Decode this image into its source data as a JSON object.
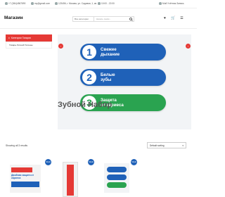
{
  "topbar": {
    "phone": "+7 (084)4567890",
    "email": "my@gmail.com",
    "address": "123456, г. Москва, ул. Садовая, 1, кв. 1",
    "hours": "10:00 - 22:00",
    "account": "Мой Учётная Запись"
  },
  "header": {
    "logo": "Магазин",
    "search_category": "Все категории",
    "search_placeholder": "Начать поиск..."
  },
  "nav": {
    "categories_button": "Категории Товаров",
    "category_item": "Товары Личной Гигиены"
  },
  "banner": {
    "item1_num": "1",
    "item1_text": "Свежее\nдыхание",
    "item2_num": "2",
    "item2_text": "Белые\nзубы",
    "item3_num": "3",
    "item3_text": "Защита\nот кариеса",
    "caption": "Зубной Набор"
  },
  "shop": {
    "result_count": "Showing all 3 results",
    "sort_label": "Default sorting"
  },
  "products": [
    {
      "badge": "SALE",
      "label": "Двойная защита от кариеса"
    },
    {
      "badge": "SALE"
    },
    {
      "badge": "SALE"
    }
  ],
  "colors": {
    "accent": "#e53935",
    "blue": "#1f61b8",
    "green": "#2aa350"
  }
}
